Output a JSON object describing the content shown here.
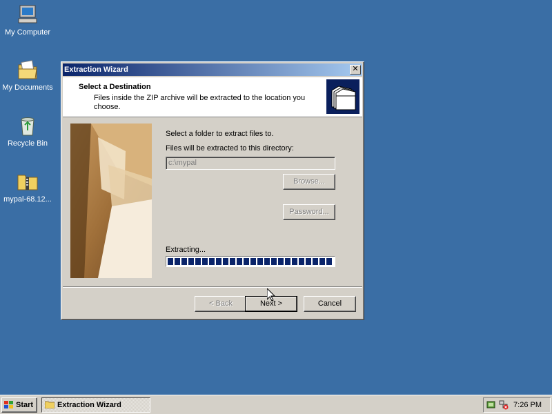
{
  "desktop": {
    "icons": [
      {
        "label": "My Computer",
        "icon": "my-computer-icon"
      },
      {
        "label": "My Documents",
        "icon": "my-documents-icon"
      },
      {
        "label": "Recycle Bin",
        "icon": "recycle-bin-icon"
      },
      {
        "label": "mypal-68.12...",
        "icon": "zip-folder-icon"
      }
    ]
  },
  "window": {
    "title": "Extraction Wizard",
    "close_label": "✕",
    "header_title": "Select a Destination",
    "header_subtitle": "Files inside the ZIP archive will be extracted to the location you choose.",
    "select_prompt": "Select a folder to extract files to.",
    "directory_label": "Files will be extracted to this directory:",
    "path_value": "c:\\mypal",
    "browse_label": "Browse...",
    "password_label": "Password...",
    "status_text": "Extracting...",
    "progress_fraction": 1.0,
    "buttons": {
      "back": "< Back",
      "next": "Next >",
      "cancel": "Cancel"
    }
  },
  "taskbar": {
    "start_label": "Start",
    "task_label": "Extraction Wizard",
    "clock": "7:26 PM"
  },
  "colors": {
    "desktop": "#3a6ea5",
    "title_start": "#0a246a",
    "title_end": "#a6caf0",
    "progress": "#0a246a"
  }
}
